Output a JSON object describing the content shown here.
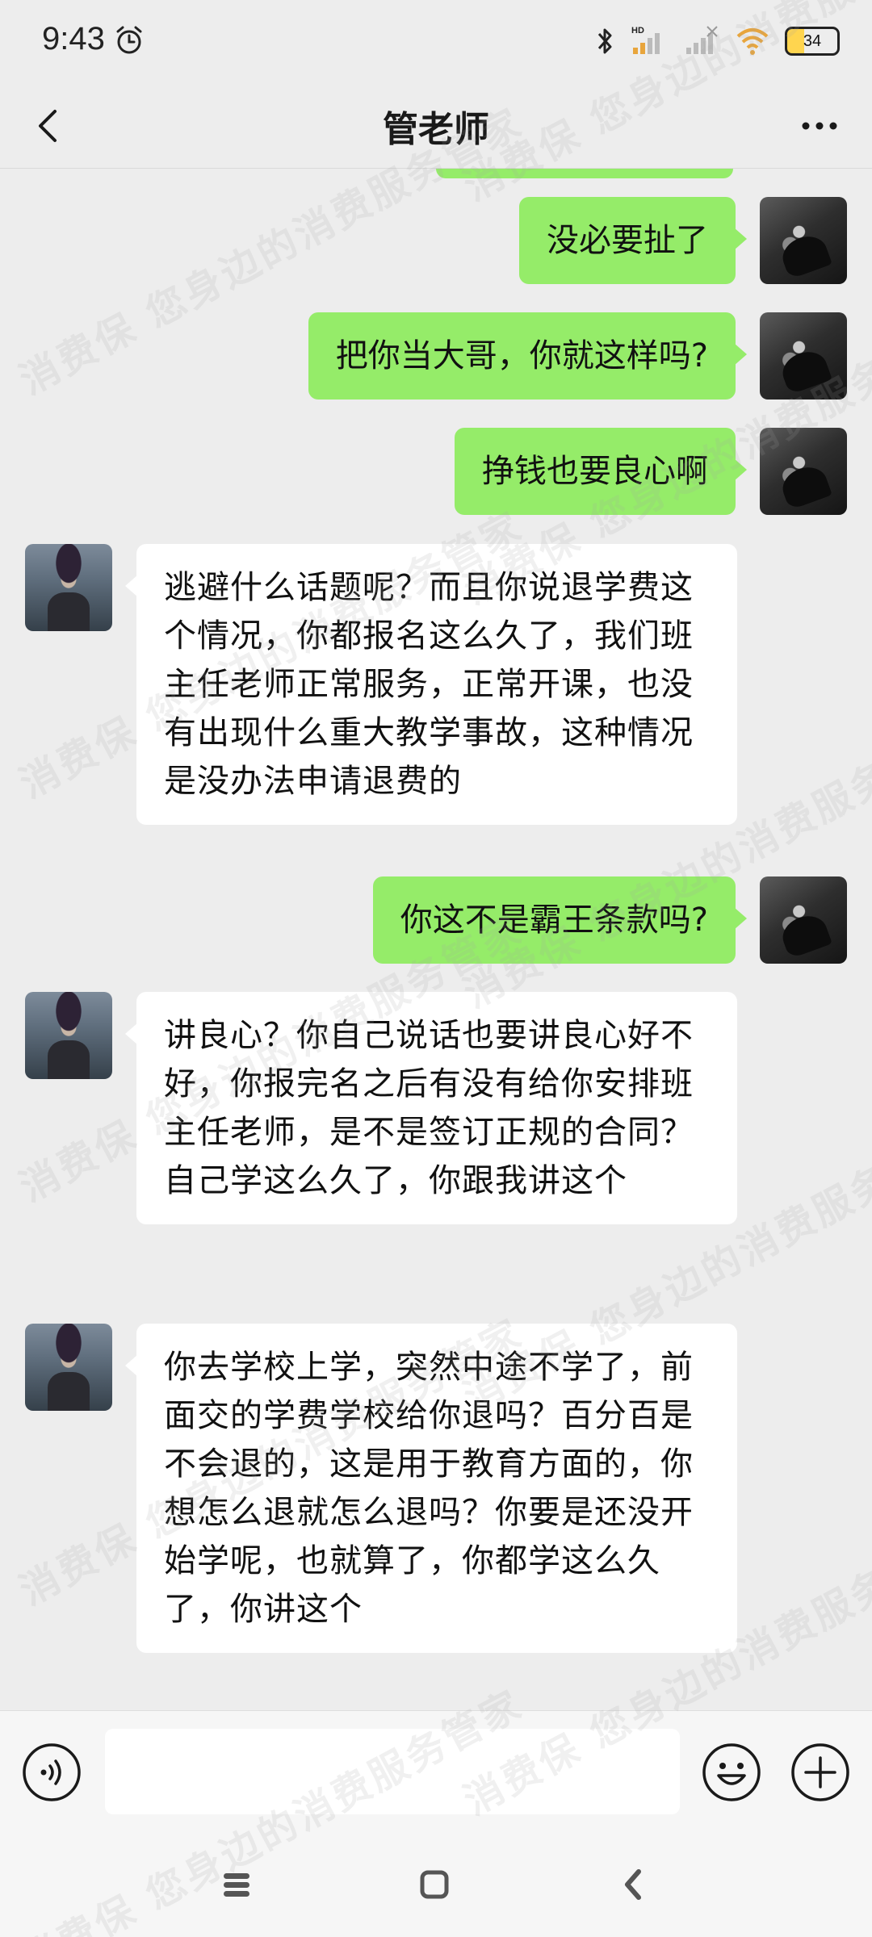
{
  "status_bar": {
    "time": "9:43",
    "battery_level": "34",
    "hd_label": "HD"
  },
  "header": {
    "title": "管老师"
  },
  "messages": [
    {
      "sender": "me",
      "text": "没必要扯了"
    },
    {
      "sender": "me",
      "text": "把你当大哥，你就这样吗?"
    },
    {
      "sender": "me",
      "text": "挣钱也要良心啊"
    },
    {
      "sender": "other",
      "text": "逃避什么话题呢？而且你说退学费这个情况，你都报名这么久了，我们班主任老师正常服务，正常开课，也没有出现什么重大教学事故，这种情况是没办法申请退费的"
    },
    {
      "sender": "me",
      "text": "你这不是霸王条款吗?"
    },
    {
      "sender": "other",
      "text": "讲良心？你自己说话也要讲良心好不好，你报完名之后有没有给你安排班主任老师，是不是签订正规的合同？自己学这么久了，你跟我讲这个"
    },
    {
      "sender": "other",
      "text": "你去学校上学，突然中途不学了，前面交的学费学校给你退吗？百分百是不会退的，这是用于教育方面的，你想怎么退就怎么退吗？你要是还没开始学呢，也就算了，你都学这么久了，你讲这个"
    }
  ],
  "input_bar": {
    "text_value": "",
    "placeholder": ""
  },
  "watermark": {
    "text": "消费保 您身边的消费服务管家"
  }
}
